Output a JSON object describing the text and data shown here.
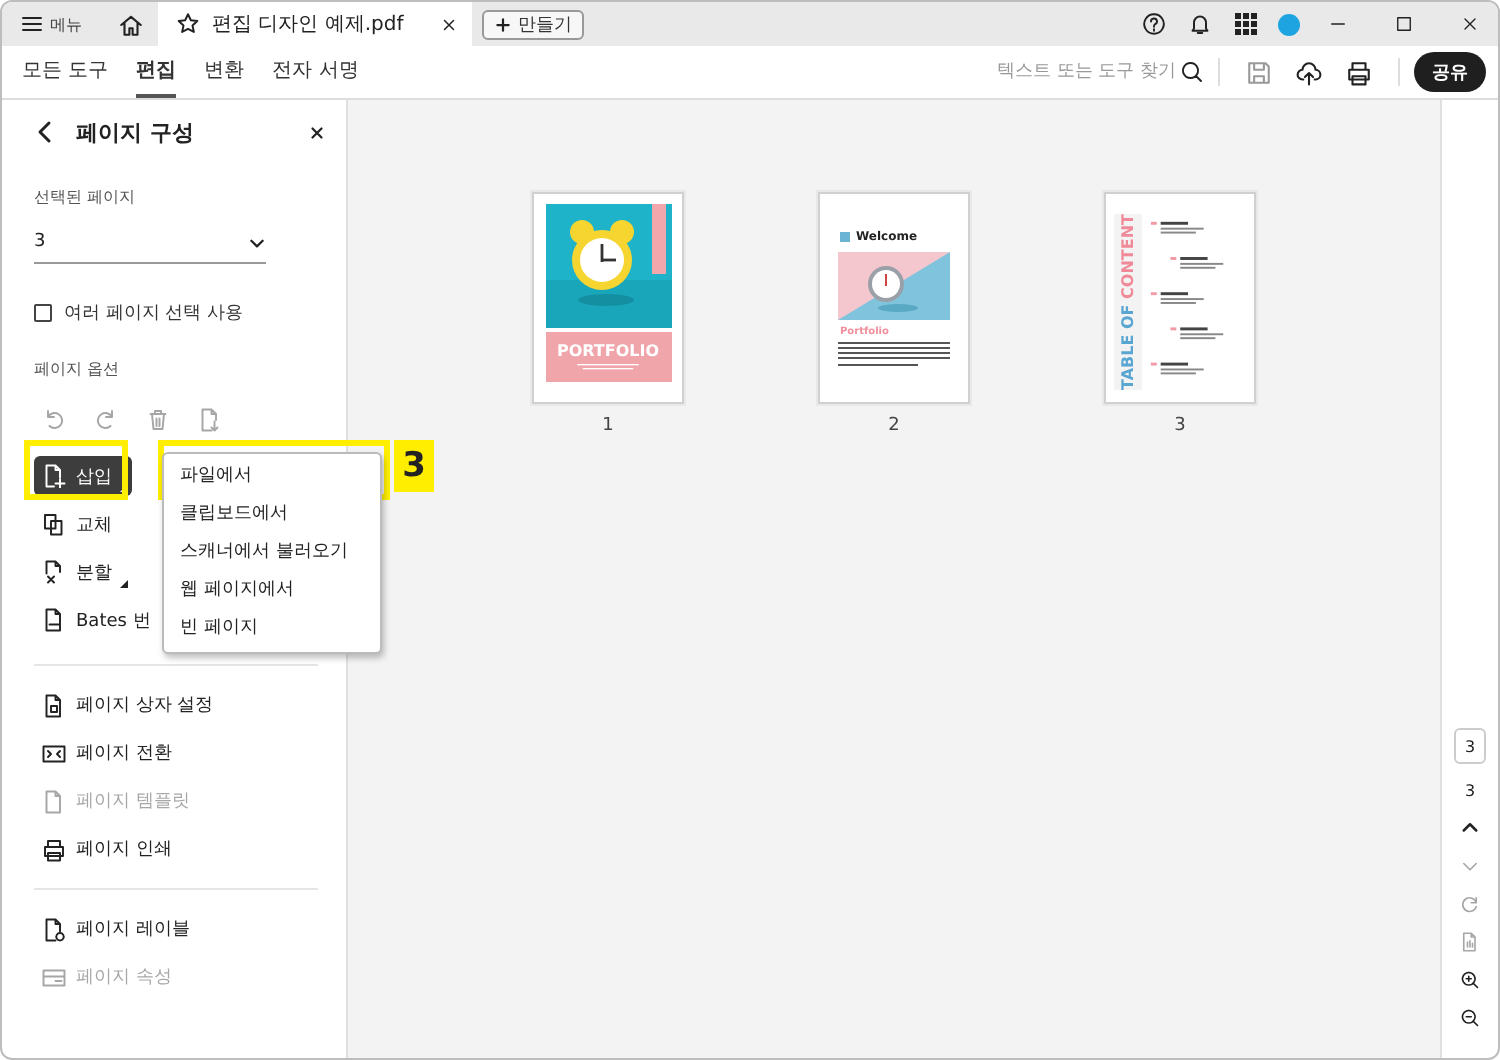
{
  "title_bar": {
    "menu_label": "메뉴",
    "tab_title": "편집 디자인 예제.pdf",
    "new_button": "만들기"
  },
  "toolbar": {
    "tabs": [
      {
        "label": "모든 도구",
        "selected": false
      },
      {
        "label": "편집",
        "selected": true
      },
      {
        "label": "변환",
        "selected": false
      },
      {
        "label": "전자 서명",
        "selected": false
      }
    ],
    "search": {
      "placeholder": "텍스트 또는 도구 찾기"
    },
    "share_button": "공유"
  },
  "panel": {
    "title": "페이지 구성",
    "selected_pages_label": "선택된 페이지",
    "selected_pages_value": "3",
    "multi_select": {
      "label": "여러 페이지 선택 사용",
      "checked": false
    },
    "options_label": "페이지 옵션",
    "icon_tools": [
      {
        "kind": "undo",
        "disabled": true
      },
      {
        "kind": "redo",
        "disabled": true
      },
      {
        "kind": "trash",
        "disabled": true
      },
      {
        "kind": "extract",
        "disabled": true
      }
    ],
    "actions": [
      {
        "kind": "insert",
        "label": "삽입",
        "selected": true,
        "has_submenu": true
      },
      {
        "kind": "replace",
        "label": "교체",
        "selected": false,
        "has_submenu": false
      },
      {
        "kind": "split",
        "label": "분할",
        "selected": false,
        "has_submenu": true
      },
      {
        "kind": "bates",
        "label": "Bates 번",
        "selected": false,
        "has_submenu": false
      }
    ],
    "tools": [
      {
        "kind": "crop",
        "label": "페이지 상자 설정",
        "disabled": false
      },
      {
        "kind": "transition",
        "label": "페이지 전환",
        "disabled": false
      },
      {
        "kind": "template",
        "label": "페이지 템플릿",
        "disabled": true
      },
      {
        "kind": "print",
        "label": "페이지 인쇄",
        "disabled": false
      }
    ],
    "tools_2": [
      {
        "kind": "label",
        "label": "페이지 레이블",
        "disabled": false
      },
      {
        "kind": "properties",
        "label": "페이지 속성",
        "disabled": true
      }
    ]
  },
  "insert_menu": {
    "items": [
      {
        "label": "파일에서"
      },
      {
        "label": "클립보드에서"
      },
      {
        "label": "스캐너에서 불러오기"
      },
      {
        "label": "웹 페이지에서"
      },
      {
        "label": "빈 페이지"
      }
    ]
  },
  "callout": {
    "number": "3"
  },
  "pages": [
    {
      "kind": "cover",
      "number": "1",
      "title": "PORTFOLIO"
    },
    {
      "kind": "welcome",
      "number": "2",
      "heading": "Welcome",
      "subheading": "Portfolio"
    },
    {
      "kind": "toc",
      "number": "3",
      "title_part_1": "TABLE OF",
      "title_part_2": "CONTENT"
    }
  ],
  "page_nav": {
    "page_field": "3",
    "page_count": "3"
  }
}
